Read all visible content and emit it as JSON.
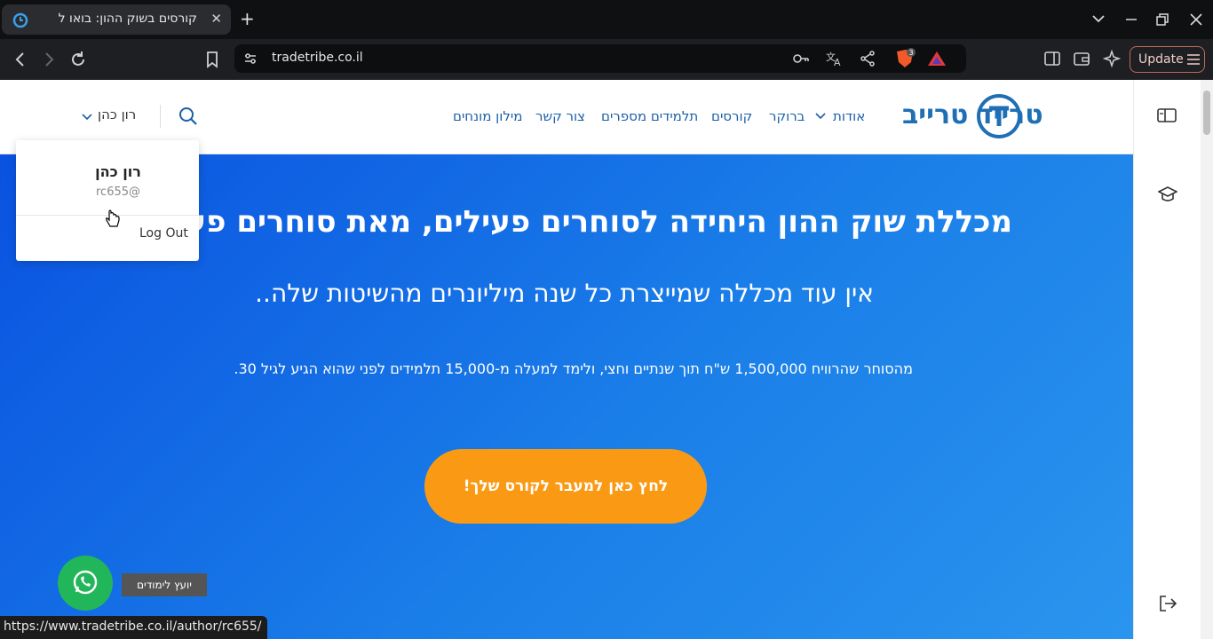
{
  "browser": {
    "tab_title": "קורסים בשוק ההון: בואו ל",
    "new_tab": "+",
    "url": "tradetribe.co.il",
    "update_label": "Update",
    "brave_badge": "3",
    "status_url": "https://www.tradetribe.co.il/author/rc655/"
  },
  "site": {
    "logo": "טרייד טרייב",
    "nav": [
      "אודות",
      "ברוקר",
      "קורסים",
      "תלמידים מספרים",
      "צור קשר",
      "מילון מונחים"
    ],
    "user_name": "רון כהן"
  },
  "dropdown": {
    "name": "רון כהן",
    "handle": "rc655@",
    "logout": "Log Out"
  },
  "hero": {
    "headline": "מכללת שוק ההון היחידה לסוחרים פעילים, מאת סוחרים פעילים",
    "subheadline": "אין עוד מכללה שמייצרת כל שנה מיליונרים מהשיטות שלה..",
    "description": "מהסוחר שהרוויח 1,500,000 ש\"ח תוך שנתיים וחצי, ולימד למעלה מ-15,000 תלמידים לפני שהוא הגיע לגיל 30.",
    "cta": "לחץ כאן למעבר לקורס שלך!"
  },
  "whatsapp": {
    "label": "יועץ לימודים"
  },
  "colors": {
    "hero_start": "#0a52e0",
    "hero_end": "#2a95ee",
    "cta": "#fa9a14",
    "brand": "#1e6fb4",
    "whatsapp": "#22b65a"
  }
}
